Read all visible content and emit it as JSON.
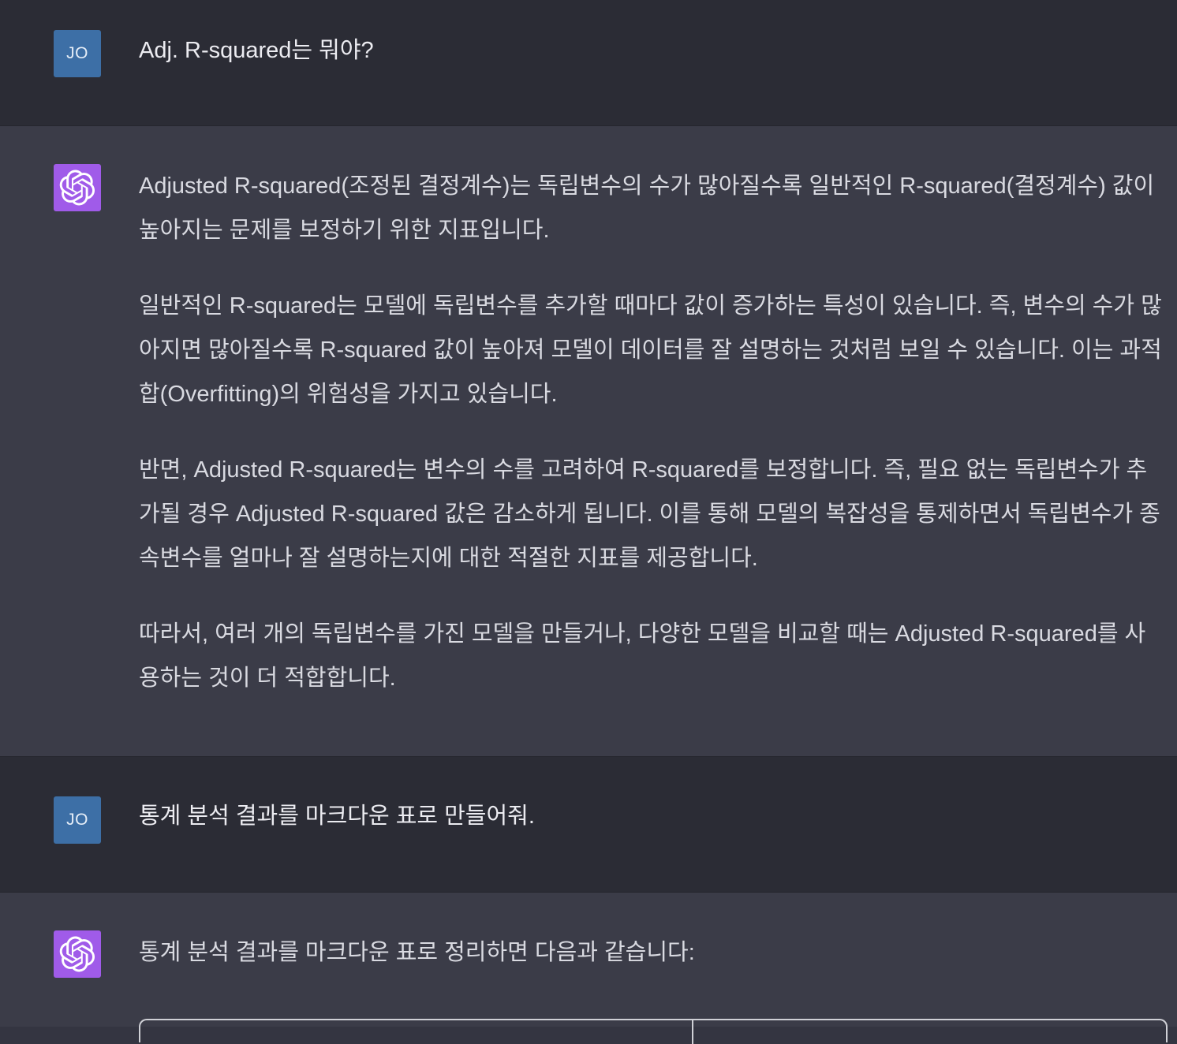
{
  "messages": [
    {
      "role": "user",
      "avatar": "JO",
      "paragraphs": [
        "Adj. R-squared는 뭐야?"
      ]
    },
    {
      "role": "assistant",
      "avatar_icon": "openai-logo-icon",
      "paragraphs": [
        "Adjusted R-squared(조정된 결정계수)는 독립변수의 수가 많아질수록 일반적인 R-squared(결정계수) 값이 높아지는 문제를 보정하기 위한 지표입니다.",
        "일반적인 R-squared는 모델에 독립변수를 추가할 때마다 값이 증가하는 특성이 있습니다. 즉, 변수의 수가 많아지면 많아질수록 R-squared 값이 높아져 모델이 데이터를 잘 설명하는 것처럼 보일 수 있습니다. 이는 과적합(Overfitting)의 위험성을 가지고 있습니다.",
        "반면, Adjusted R-squared는 변수의 수를 고려하여 R-squared를 보정합니다. 즉, 필요 없는 독립변수가 추가될 경우 Adjusted R-squared 값은 감소하게 됩니다. 이를 통해 모델의 복잡성을 통제하면서 독립변수가 종속변수를 얼마나 잘 설명하는지에 대한 적절한 지표를 제공합니다.",
        "따라서, 여러 개의 독립변수를 가진 모델을 만들거나, 다양한 모델을 비교할 때는 Adjusted R-squared를 사용하는 것이 더 적합합니다."
      ]
    },
    {
      "role": "user",
      "avatar": "JO",
      "paragraphs": [
        "통계 분석 결과를 마크다운 표로 만들어줘."
      ]
    },
    {
      "role": "assistant",
      "avatar_icon": "openai-logo-icon",
      "paragraphs": [
        "통계 분석 결과를 마크다운 표로 정리하면 다음과 같습니다:"
      ]
    }
  ],
  "colors": {
    "user_bg": "#2b2c35",
    "assistant_bg": "#3b3c48",
    "user_avatar": "#3d6fa6",
    "assistant_avatar": "#a05be9"
  }
}
